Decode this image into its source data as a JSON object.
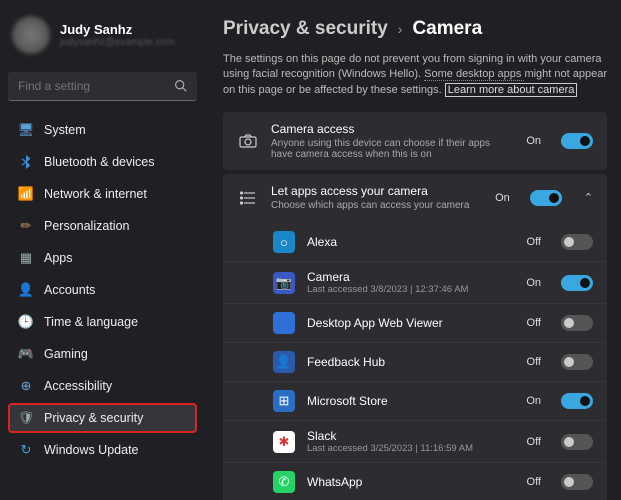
{
  "profile": {
    "name": "Judy Sanhz",
    "email": "judysanhz@example.com"
  },
  "search": {
    "placeholder": "Find a setting"
  },
  "nav": [
    {
      "label": "System",
      "icon": "🖥",
      "color": "#5aa0d8"
    },
    {
      "label": "Bluetooth & devices",
      "icon": "B",
      "color": "#3a8fd8",
      "bt": true
    },
    {
      "label": "Network & internet",
      "icon": "📶",
      "color": "#3aa7e0"
    },
    {
      "label": "Personalization",
      "icon": "✏",
      "color": "#c79a5a"
    },
    {
      "label": "Apps",
      "icon": "▦",
      "color": "#9aa"
    },
    {
      "label": "Accounts",
      "icon": "👤",
      "color": "#aab"
    },
    {
      "label": "Time & language",
      "icon": "🕒",
      "color": "#aab"
    },
    {
      "label": "Gaming",
      "icon": "🎮",
      "color": "#9aa"
    },
    {
      "label": "Accessibility",
      "icon": "⊕",
      "color": "#6aa0d8"
    },
    {
      "label": "Privacy & security",
      "icon": "🛡",
      "color": "#9aa",
      "active": true,
      "highlighted": true
    },
    {
      "label": "Windows Update",
      "icon": "↻",
      "color": "#3aa7e0"
    }
  ],
  "breadcrumb": {
    "parent": "Privacy & security",
    "current": "Camera"
  },
  "desc": {
    "t1": "The settings on this page do not prevent you from signing in with your camera using facial recognition (Windows Hello). ",
    "dotted": "Some desktop apps ",
    "t2": "might not appear on this page or be affected by these settings. ",
    "link": "Learn more about camera"
  },
  "cards": {
    "access": {
      "title": "Camera access",
      "sub": "Anyone using this device can choose if their apps have camera access when this is on",
      "state": "On",
      "on": true
    },
    "apps": {
      "title": "Let apps access your camera",
      "sub": "Choose which apps can access your camera",
      "state": "On",
      "on": true
    }
  },
  "apps": [
    {
      "name": "Alexa",
      "sub": "",
      "state": "Off",
      "on": false,
      "bg": "#1a87c9",
      "icon": "○"
    },
    {
      "name": "Camera",
      "sub": "Last accessed 3/8/2023 | 12:37:46 AM",
      "state": "On",
      "on": true,
      "bg": "#3a58c4",
      "icon": "📷"
    },
    {
      "name": "Desktop App Web Viewer",
      "sub": "",
      "state": "Off",
      "on": false,
      "bg": "#2f6fd8",
      "icon": ""
    },
    {
      "name": "Feedback Hub",
      "sub": "",
      "state": "Off",
      "on": false,
      "bg": "#2b5aa8",
      "icon": "👤"
    },
    {
      "name": "Microsoft Store",
      "sub": "",
      "state": "On",
      "on": true,
      "bg": "#2a6ec4",
      "icon": "⊞"
    },
    {
      "name": "Slack",
      "sub": "Last accessed 3/25/2023 | 11:16:59 AM",
      "state": "Off",
      "on": false,
      "bg": "#fff",
      "icon": "✱",
      "fg": "#d33"
    },
    {
      "name": "WhatsApp",
      "sub": "",
      "state": "Off",
      "on": false,
      "bg": "#25d366",
      "icon": "✆"
    }
  ]
}
